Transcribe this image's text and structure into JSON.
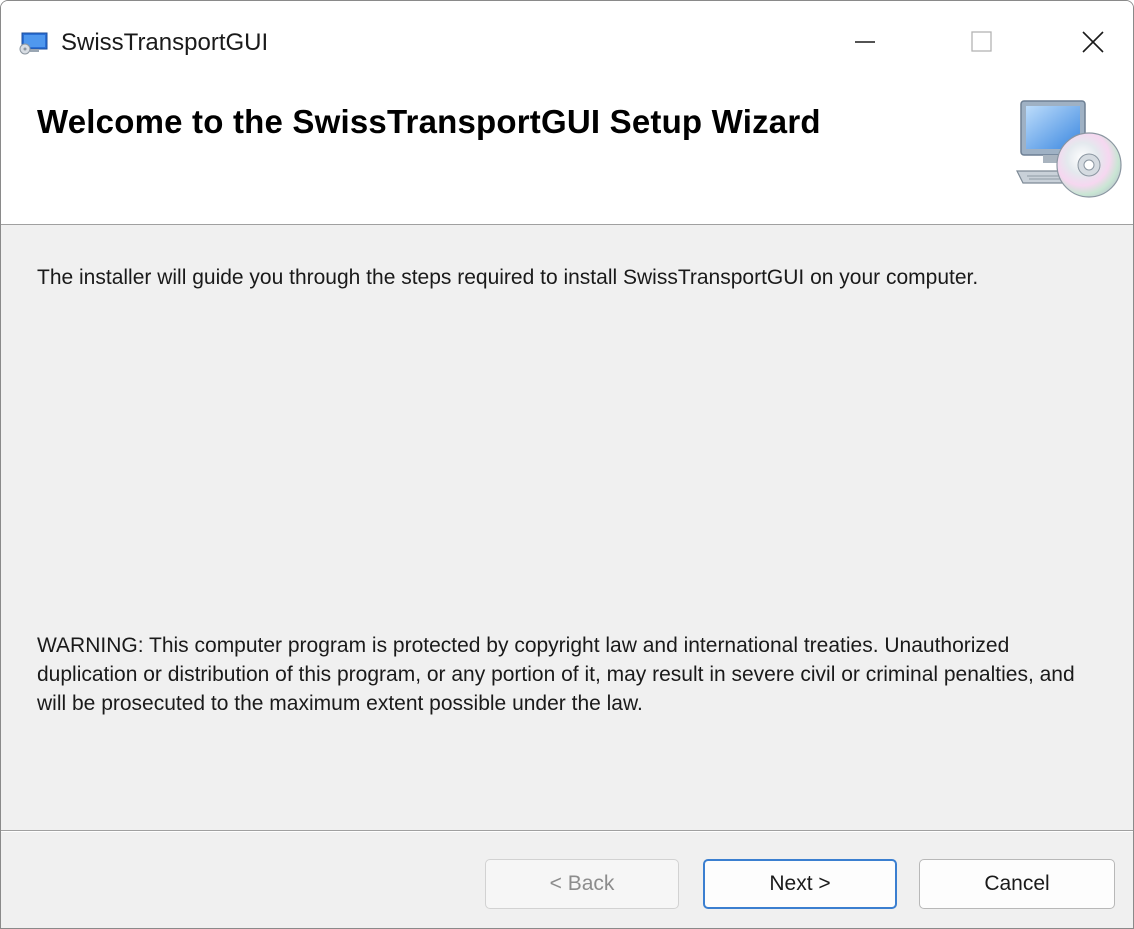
{
  "window": {
    "title": "SwissTransportGUI",
    "controls": {
      "minimize": "minimize-icon",
      "maximize": "maximize-icon",
      "close": "close-icon"
    }
  },
  "header": {
    "title": "Welcome to the SwissTransportGUI Setup Wizard",
    "icon": "computer-cd-icon"
  },
  "content": {
    "intro": "The installer will guide you through the steps required to install SwissTransportGUI on your computer.",
    "warning": "WARNING: This computer program is protected by copyright law and international treaties. Unauthorized duplication or distribution of this program, or any portion of it, may result in severe civil or criminal penalties, and will be prosecuted to the maximum extent possible under the law."
  },
  "buttons": {
    "back": "< Back",
    "next": "Next >",
    "cancel": "Cancel"
  },
  "colors": {
    "accent": "#3b7fd0",
    "dialog_bg": "#f0f0f0"
  }
}
